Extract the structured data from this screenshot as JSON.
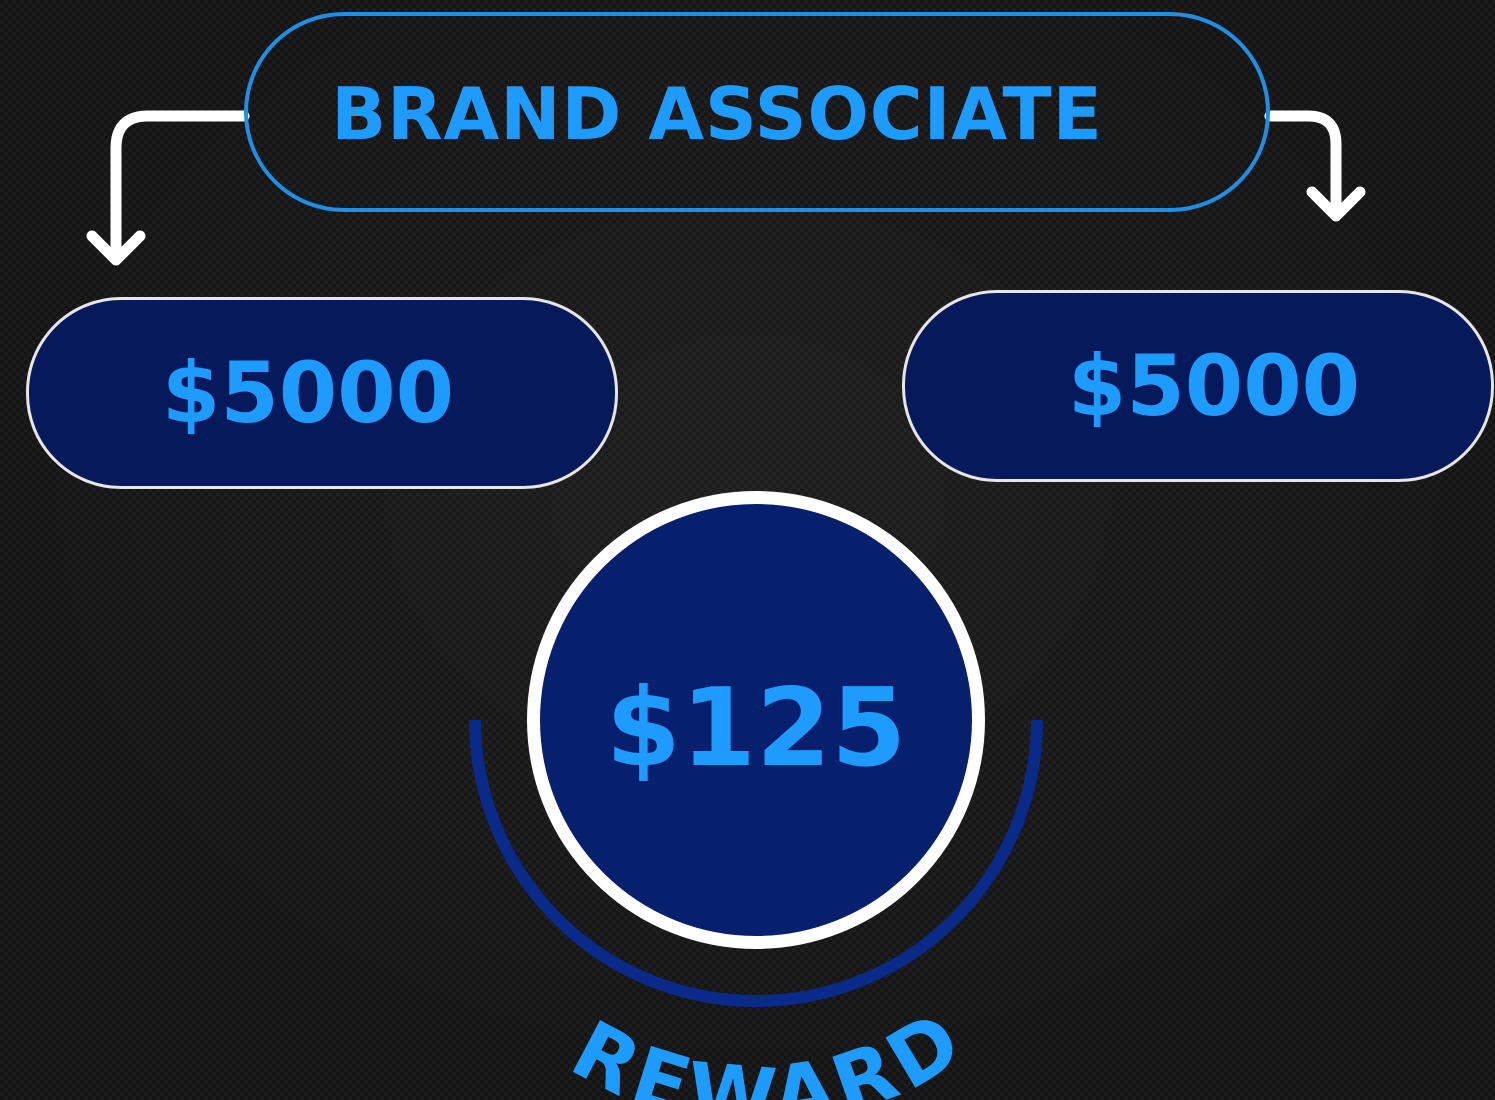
{
  "title": "BRAND ASSOCIATE",
  "left_amount": "$5000",
  "right_amount": "$5000",
  "reward_amount": "$125",
  "reward_label": "REWARD",
  "colors": {
    "accent_blue": "#1e9bff",
    "pill_fill": "#06195a",
    "circle_fill": "#06206e",
    "arc": "#0a2a8a",
    "background": "#141414",
    "connector": "#ffffff"
  }
}
